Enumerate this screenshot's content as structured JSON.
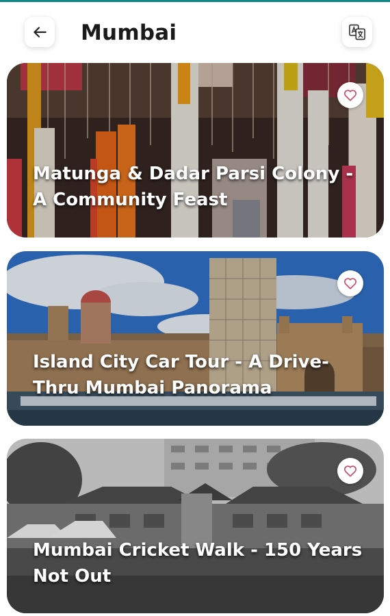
{
  "header": {
    "title": "Mumbai",
    "back_icon": "arrow-left-icon",
    "translate_icon": "translate-icon"
  },
  "accent_color": "#0f8a86",
  "favorite_color": "#c9526b",
  "tours": [
    {
      "title": "Matunga & Dadar Parsi Colony - A Community Feast",
      "favorite_icon": "heart-outline-icon"
    },
    {
      "title": "Island City Car Tour -  A Drive-Thru Mumbai Panorama",
      "favorite_icon": "heart-outline-icon"
    },
    {
      "title": "Mumbai Cricket Walk - 150 Years Not Out",
      "favorite_icon": "heart-outline-icon"
    }
  ]
}
